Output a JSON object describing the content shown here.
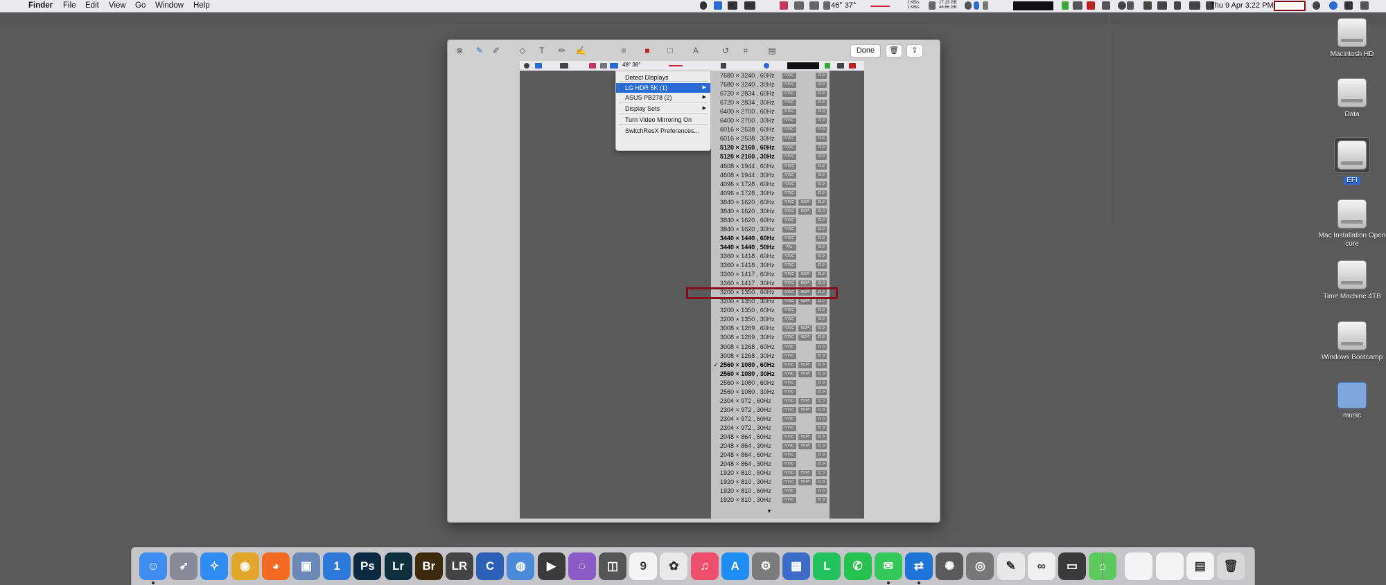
{
  "menubar": {
    "app": "Finder",
    "menus": [
      "File",
      "Edit",
      "View",
      "Go",
      "Window",
      "Help"
    ],
    "temps": "46° 37°",
    "net": [
      "1 KB/s",
      "1 KB/s"
    ],
    "mem": [
      "17.13 GB",
      "46.66 GB"
    ],
    "clock": "Thu 9 Apr  3:22 PM"
  },
  "window": {
    "done_label": "Done",
    "inner_temps": "48° 38°"
  },
  "display_menu": {
    "items": [
      {
        "label": "Detect Displays",
        "submenu": false,
        "selected": false
      },
      {
        "label": "LG HDR 5K (1)",
        "submenu": true,
        "selected": true
      },
      {
        "label": "ASUS PB278 (2)",
        "submenu": true,
        "selected": false
      },
      {
        "label": "Display Sets",
        "submenu": true,
        "selected": false
      },
      {
        "label": "Turn Video Mirroring On",
        "submenu": false,
        "selected": false
      },
      {
        "label": "SwitchResX Preferences...",
        "submenu": false,
        "selected": false
      }
    ]
  },
  "resolutions": {
    "rows": [
      {
        "label": "7680 × 3240 , 60Hz",
        "bold": false,
        "check": false,
        "tags": [
          "NTSC"
        ],
        "ratio": "21:9"
      },
      {
        "label": "7680 × 3240 , 30Hz",
        "bold": false,
        "check": false,
        "tags": [
          "NTSC"
        ],
        "ratio": "21:9"
      },
      {
        "label": "6720 × 2834 , 60Hz",
        "bold": false,
        "check": false,
        "tags": [
          "NTSC"
        ],
        "ratio": "21:9"
      },
      {
        "label": "6720 × 2834 , 30Hz",
        "bold": false,
        "check": false,
        "tags": [
          "NTSC"
        ],
        "ratio": "21:9"
      },
      {
        "label": "6400 × 2700 , 60Hz",
        "bold": false,
        "check": false,
        "tags": [
          "NTSC"
        ],
        "ratio": "21:9"
      },
      {
        "label": "6400 × 2700 , 30Hz",
        "bold": false,
        "check": false,
        "tags": [
          "NTSC"
        ],
        "ratio": "21:9"
      },
      {
        "label": "6016 × 2538 , 60Hz",
        "bold": false,
        "check": false,
        "tags": [
          "NTSC"
        ],
        "ratio": "21:9"
      },
      {
        "label": "6016 × 2538 , 30Hz",
        "bold": false,
        "check": false,
        "tags": [
          "NTSC"
        ],
        "ratio": "21:9"
      },
      {
        "label": "5120 × 2160 , 60Hz",
        "bold": true,
        "check": false,
        "tags": [
          "NTSC"
        ],
        "ratio": "21:9"
      },
      {
        "label": "5120 × 2160 , 30Hz",
        "bold": true,
        "check": false,
        "tags": [
          "NTSC"
        ],
        "ratio": "21:9"
      },
      {
        "label": "4608 × 1944 , 60Hz",
        "bold": false,
        "check": false,
        "tags": [
          "NTSC"
        ],
        "ratio": "21:9"
      },
      {
        "label": "4608 × 1944 , 30Hz",
        "bold": false,
        "check": false,
        "tags": [
          "NTSC"
        ],
        "ratio": "21:9"
      },
      {
        "label": "4096 × 1728 , 60Hz",
        "bold": false,
        "check": false,
        "tags": [
          "NTSC"
        ],
        "ratio": "21:9"
      },
      {
        "label": "4096 × 1728 , 30Hz",
        "bold": false,
        "check": false,
        "tags": [
          "NTSC"
        ],
        "ratio": "21:9"
      },
      {
        "label": "3840 × 1620 , 60Hz",
        "bold": false,
        "check": false,
        "tags": [
          "NTSC",
          "HiDPI"
        ],
        "ratio": "21:9"
      },
      {
        "label": "3840 × 1620 , 30Hz",
        "bold": false,
        "check": false,
        "tags": [
          "NTSC",
          "HiDPI"
        ],
        "ratio": "21:9"
      },
      {
        "label": "3840 × 1620 , 60Hz",
        "bold": false,
        "check": false,
        "tags": [
          "NTSC"
        ],
        "ratio": "21:9"
      },
      {
        "label": "3840 × 1620 , 30Hz",
        "bold": false,
        "check": false,
        "tags": [
          "NTSC"
        ],
        "ratio": "21:9"
      },
      {
        "label": "3440 × 1440 , 60Hz",
        "bold": true,
        "check": false,
        "tags": [
          "NTSC"
        ],
        "ratio": "21:9"
      },
      {
        "label": "3440 × 1440 , 50Hz",
        "bold": true,
        "check": false,
        "tags": [
          "PAL"
        ],
        "ratio": "21:9"
      },
      {
        "label": "3360 × 1418 , 60Hz",
        "bold": false,
        "check": false,
        "tags": [
          "NTSC"
        ],
        "ratio": "21:9"
      },
      {
        "label": "3360 × 1418 , 30Hz",
        "bold": false,
        "check": false,
        "tags": [
          "NTSC"
        ],
        "ratio": "21:9"
      },
      {
        "label": "3360 × 1417 , 60Hz",
        "bold": false,
        "check": false,
        "tags": [
          "NTSC",
          "HiDPI"
        ],
        "ratio": "21:9"
      },
      {
        "label": "3360 × 1417 , 30Hz",
        "bold": false,
        "check": false,
        "tags": [
          "NTSC",
          "HiDPI"
        ],
        "ratio": "21:9"
      },
      {
        "label": "3200 × 1350 , 60Hz",
        "bold": false,
        "check": false,
        "tags": [
          "NTSC",
          "HiDPI"
        ],
        "ratio": "21:9"
      },
      {
        "label": "3200 × 1350 , 30Hz",
        "bold": false,
        "check": false,
        "tags": [
          "NTSC",
          "HiDPI"
        ],
        "ratio": "21:9"
      },
      {
        "label": "3200 × 1350 , 60Hz",
        "bold": false,
        "check": false,
        "tags": [
          "NTSC"
        ],
        "ratio": "21:9"
      },
      {
        "label": "3200 × 1350 , 30Hz",
        "bold": false,
        "check": false,
        "tags": [
          "NTSC"
        ],
        "ratio": "21:9"
      },
      {
        "label": "3008 × 1269 , 60Hz",
        "bold": false,
        "check": false,
        "tags": [
          "NTSC",
          "HiDPI"
        ],
        "ratio": "21:9"
      },
      {
        "label": "3008 × 1269 , 30Hz",
        "bold": false,
        "check": false,
        "tags": [
          "NTSC",
          "HiDPI"
        ],
        "ratio": "21:9"
      },
      {
        "label": "3008 × 1268 , 60Hz",
        "bold": false,
        "check": false,
        "tags": [
          "NTSC"
        ],
        "ratio": "21:9"
      },
      {
        "label": "3008 × 1268 , 30Hz",
        "bold": false,
        "check": false,
        "tags": [
          "NTSC"
        ],
        "ratio": "21:9"
      },
      {
        "label": "2560 × 1080 , 60Hz",
        "bold": true,
        "check": true,
        "tags": [
          "NTSC",
          "HiDPI"
        ],
        "ratio": "21:9"
      },
      {
        "label": "2560 × 1080 , 30Hz",
        "bold": true,
        "check": false,
        "tags": [
          "NTSC",
          "HiDPI"
        ],
        "ratio": "21:9"
      },
      {
        "label": "2560 × 1080 , 60Hz",
        "bold": false,
        "check": false,
        "tags": [
          "NTSC"
        ],
        "ratio": "21:9"
      },
      {
        "label": "2560 × 1080 , 30Hz",
        "bold": false,
        "check": false,
        "tags": [
          "NTSC"
        ],
        "ratio": "21:9"
      },
      {
        "label": "2304 × 972  , 60Hz",
        "bold": false,
        "check": false,
        "tags": [
          "NTSC",
          "HiDPI"
        ],
        "ratio": "21:9"
      },
      {
        "label": "2304 × 972  , 30Hz",
        "bold": false,
        "check": false,
        "tags": [
          "NTSC",
          "HiDPI"
        ],
        "ratio": "21:9"
      },
      {
        "label": "2304 × 972  , 60Hz",
        "bold": false,
        "check": false,
        "tags": [
          "NTSC"
        ],
        "ratio": "21:9"
      },
      {
        "label": "2304 × 972  , 30Hz",
        "bold": false,
        "check": false,
        "tags": [
          "NTSC"
        ],
        "ratio": "21:9"
      },
      {
        "label": "2048 × 864  , 60Hz",
        "bold": false,
        "check": false,
        "tags": [
          "NTSC",
          "HiDPI"
        ],
        "ratio": "21:9"
      },
      {
        "label": "2048 × 864  , 30Hz",
        "bold": false,
        "check": false,
        "tags": [
          "NTSC",
          "HiDPI"
        ],
        "ratio": "21:9"
      },
      {
        "label": "2048 × 864  , 60Hz",
        "bold": false,
        "check": false,
        "tags": [
          "NTSC"
        ],
        "ratio": "21:9"
      },
      {
        "label": "2048 × 864  , 30Hz",
        "bold": false,
        "check": false,
        "tags": [
          "NTSC"
        ],
        "ratio": "21:9"
      },
      {
        "label": "1920 × 810  , 60Hz",
        "bold": false,
        "check": false,
        "tags": [
          "NTSC",
          "HiDPI"
        ],
        "ratio": "21:9"
      },
      {
        "label": "1920 × 810  , 30Hz",
        "bold": false,
        "check": false,
        "tags": [
          "NTSC",
          "HiDPI"
        ],
        "ratio": "21:9"
      },
      {
        "label": "1920 × 810  , 60Hz",
        "bold": false,
        "check": false,
        "tags": [
          "NTSC"
        ],
        "ratio": "21:9"
      },
      {
        "label": "1920 × 810  , 30Hz",
        "bold": false,
        "check": false,
        "tags": [
          "NTSC"
        ],
        "ratio": "21:9"
      }
    ],
    "highlighted_index": 24,
    "scroll_arrow": "▼"
  },
  "desktop": {
    "icons": [
      {
        "label": "Macintosh HD",
        "kind": "drive",
        "selected": false
      },
      {
        "label": "Data",
        "kind": "drive",
        "selected": false
      },
      {
        "label": "EFI",
        "kind": "drive",
        "selected": true
      },
      {
        "label": "Mac Installation Open core",
        "kind": "drive",
        "selected": false
      },
      {
        "label": "Time Machine 4TB",
        "kind": "drive",
        "selected": false
      },
      {
        "label": "Windows Bootcamp",
        "kind": "drive",
        "selected": false
      },
      {
        "label": "music",
        "kind": "folder",
        "selected": false
      }
    ]
  },
  "dock": {
    "apps": [
      {
        "name": "finder-icon",
        "color": "#3d8ef0",
        "glyph": "☺",
        "dot": true
      },
      {
        "name": "launchpad-icon",
        "color": "#8a8a98",
        "glyph": "➶",
        "dot": false
      },
      {
        "name": "safari-icon",
        "color": "#2f8cf3",
        "glyph": "✧",
        "dot": false
      },
      {
        "name": "chrome-icon",
        "color": "#e1a62a",
        "glyph": "◉",
        "dot": false
      },
      {
        "name": "firefox-icon",
        "color": "#f26a1f",
        "glyph": "◕",
        "dot": false
      },
      {
        "name": "preview-icon",
        "color": "#6a89b8",
        "glyph": "▣",
        "dot": false
      },
      {
        "name": "1password-icon",
        "color": "#2d79d9",
        "glyph": "1",
        "dot": false
      },
      {
        "name": "photoshop-icon",
        "color": "#0c2b42",
        "glyph": "Ps",
        "dot": false
      },
      {
        "name": "lightroom-icon",
        "color": "#0d2f3e",
        "glyph": "Lr",
        "dot": false
      },
      {
        "name": "bridge-icon",
        "color": "#3b2a0c",
        "glyph": "Br",
        "dot": false
      },
      {
        "name": "lrtimelapse-icon",
        "color": "#444",
        "glyph": "LR",
        "dot": false
      },
      {
        "name": "c1-icon",
        "color": "#2c5fb6",
        "glyph": "C",
        "dot": false
      },
      {
        "name": "globe-icon",
        "color": "#4a8ad8",
        "glyph": "◍",
        "dot": false
      },
      {
        "name": "fcp-icon",
        "color": "#3b3b3b",
        "glyph": "▶",
        "dot": false
      },
      {
        "name": "motion-icon",
        "color": "#8b5cc7",
        "glyph": "◌",
        "dot": false
      },
      {
        "name": "compressor-icon",
        "color": "#555",
        "glyph": "◫",
        "dot": false
      },
      {
        "name": "calendar-icon",
        "color": "#f4f4f4",
        "glyph": "9",
        "dot": false
      },
      {
        "name": "photos-icon",
        "color": "#e9e9e9",
        "glyph": "✿",
        "dot": false
      },
      {
        "name": "music-icon",
        "color": "#f04e6d",
        "glyph": "♫",
        "dot": false
      },
      {
        "name": "appstore-icon",
        "color": "#1e8df4",
        "glyph": "A",
        "dot": false
      },
      {
        "name": "system-preferences-icon",
        "color": "#7b7b7b",
        "glyph": "⚙",
        "dot": false
      },
      {
        "name": "switchresx-icon",
        "color": "#3b6cc8",
        "glyph": "▦",
        "dot": false
      },
      {
        "name": "line-icon",
        "color": "#22c35e",
        "glyph": "L",
        "dot": false
      },
      {
        "name": "whatsapp-icon",
        "color": "#25c24f",
        "glyph": "✆",
        "dot": false
      },
      {
        "name": "messages-icon",
        "color": "#34c759",
        "glyph": "✉",
        "dot": true
      },
      {
        "name": "teamviewer-icon",
        "color": "#1f74d8",
        "glyph": "⇄",
        "dot": true
      },
      {
        "name": "istat-icon",
        "color": "#5a5a5a",
        "glyph": "✺",
        "dot": false
      },
      {
        "name": "screenshot-icon",
        "color": "#777",
        "glyph": "◎",
        "dot": false
      },
      {
        "name": "textedit-icon",
        "color": "#e8e8e8",
        "glyph": "✎",
        "dot": false
      },
      {
        "name": "airflow-icon",
        "color": "#f0f0f0",
        "glyph": "∞",
        "dot": false
      },
      {
        "name": "obs-icon",
        "color": "#3a3a3a",
        "glyph": "▭",
        "dot": false
      },
      {
        "name": "home-icon",
        "color": "#5cc95c",
        "glyph": "⌂",
        "dot": false
      },
      {
        "name": "window-thumb-1-icon",
        "color": "#f4f4f4",
        "glyph": "",
        "dot": false
      },
      {
        "name": "window-thumb-2-icon",
        "color": "#f4f4f4",
        "glyph": "",
        "dot": false
      },
      {
        "name": "window-thumb-3-icon",
        "color": "#f4f4f4",
        "glyph": "▤",
        "dot": false
      },
      {
        "name": "trash-icon",
        "color": "#d8d8d8",
        "glyph": "🗑",
        "dot": false
      }
    ]
  }
}
